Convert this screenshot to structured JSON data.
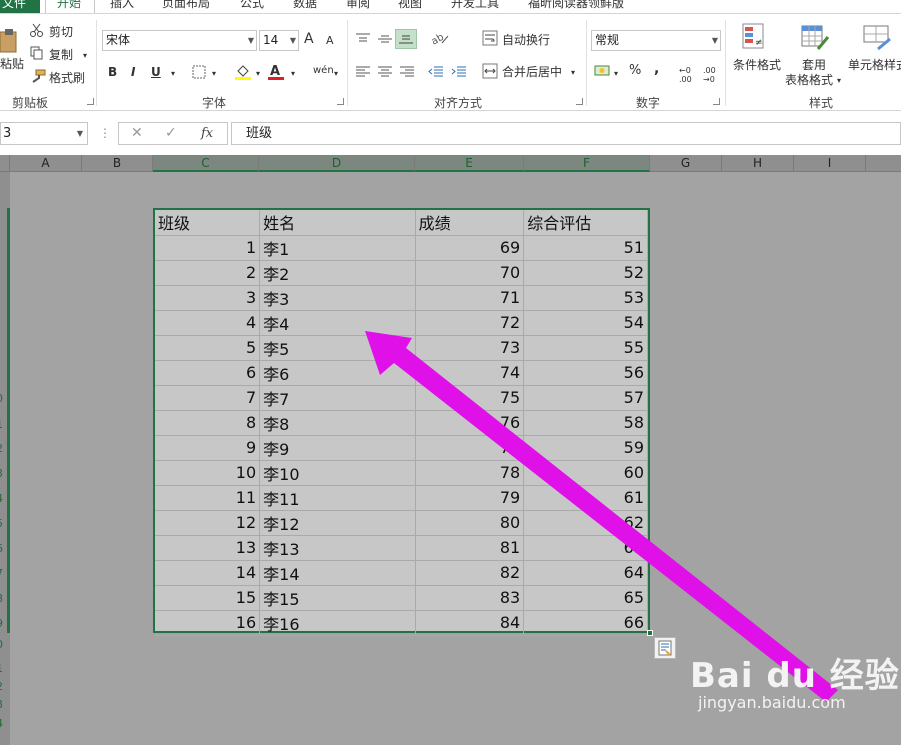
{
  "ribbon_tabs": {
    "file": "文件",
    "home": "开始",
    "insert": "插入",
    "page_layout": "页面布局",
    "formulas": "公式",
    "data": "数据",
    "review": "审阅",
    "view": "视图",
    "developer": "开发工具",
    "foxit": "福昕阅读器领鲜版"
  },
  "clipboard": {
    "paste": "粘贴",
    "cut": "剪切",
    "copy": "复制",
    "format_painter": "格式刷",
    "group": "剪贴板"
  },
  "font": {
    "name": "宋体",
    "size": "14",
    "grow": "A",
    "shrink": "A",
    "bold": "B",
    "italic": "I",
    "underline": "U",
    "group": "字体",
    "phonetic": "wén"
  },
  "alignment": {
    "wrap_text": "自动换行",
    "merge_center": "合并后居中",
    "group": "对齐方式"
  },
  "number": {
    "format": "常规",
    "percent": "%",
    "comma": ",",
    "group": "数字",
    "inc_dec": "←0 .00",
    "dec_dec": ".00 →0"
  },
  "styles": {
    "conditional": "条件格式",
    "table_format_1": "套用",
    "table_format_2": "表格格式",
    "cell_styles": "单元格样式",
    "group": "样式"
  },
  "formula_bar": {
    "name_box": "3",
    "fx": "fx",
    "content": "班级"
  },
  "columns": [
    "A",
    "B",
    "C",
    "D",
    "E",
    "F",
    "G",
    "H",
    "I"
  ],
  "row_numbers": [
    "0",
    "1",
    "2",
    "3",
    "4",
    "5",
    "6",
    "7",
    "8",
    "9",
    "0",
    "1",
    "2",
    "3",
    "4"
  ],
  "table": {
    "headers": [
      "班级",
      "姓名",
      "成绩",
      "综合评估"
    ],
    "rows": [
      [
        "1",
        "李1",
        "69",
        "51"
      ],
      [
        "2",
        "李2",
        "70",
        "52"
      ],
      [
        "3",
        "李3",
        "71",
        "53"
      ],
      [
        "4",
        "李4",
        "72",
        "54"
      ],
      [
        "5",
        "李5",
        "73",
        "55"
      ],
      [
        "6",
        "李6",
        "74",
        "56"
      ],
      [
        "7",
        "李7",
        "75",
        "57"
      ],
      [
        "8",
        "李8",
        "76",
        "58"
      ],
      [
        "9",
        "李9",
        "77",
        "59"
      ],
      [
        "10",
        "李10",
        "78",
        "60"
      ],
      [
        "11",
        "李11",
        "79",
        "61"
      ],
      [
        "12",
        "李12",
        "80",
        "62"
      ],
      [
        "13",
        "李13",
        "81",
        "63"
      ],
      [
        "14",
        "李14",
        "82",
        "64"
      ],
      [
        "15",
        "李15",
        "83",
        "65"
      ],
      [
        "16",
        "李16",
        "84",
        "66"
      ]
    ]
  },
  "watermark": {
    "logo": "Bai du 经验",
    "url": "jingyan.baidu.com"
  },
  "colors": {
    "excel_green": "#217346",
    "arrow": "#e011e8",
    "grid_bg": "#a3a3a3"
  }
}
